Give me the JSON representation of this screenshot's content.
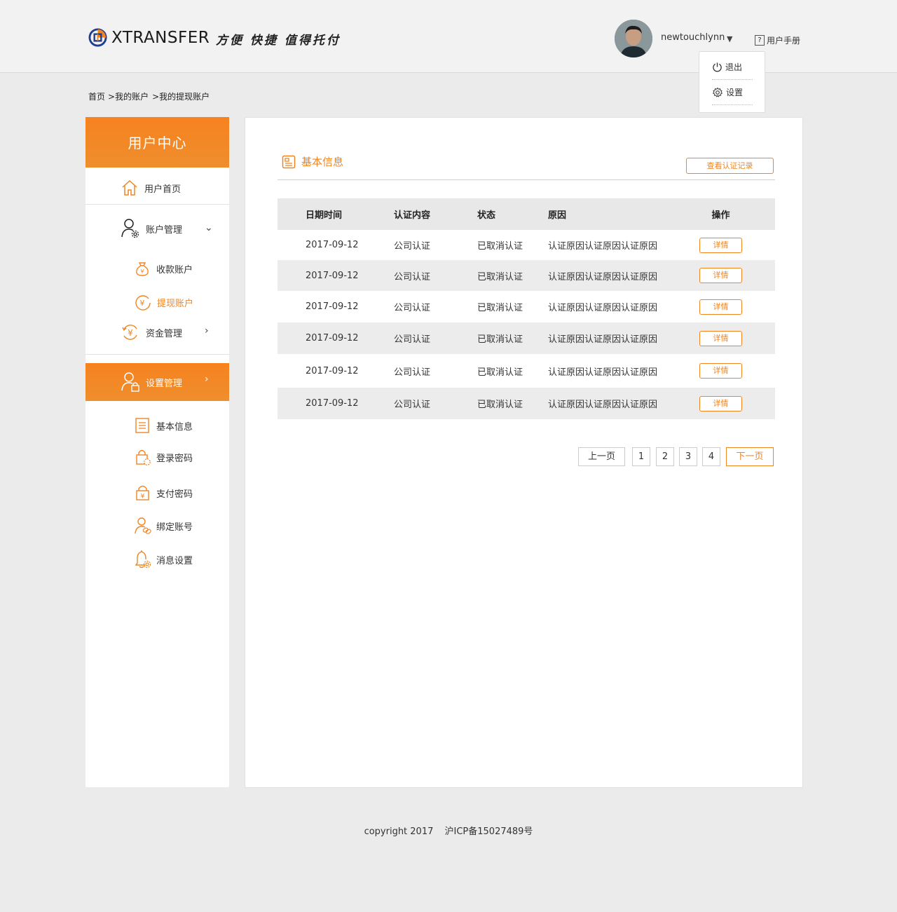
{
  "brand": {
    "name": "XTRANSFER",
    "slogan": "方便 快捷 值得托付"
  },
  "header": {
    "username": "newtouchlynn",
    "manual_label": "用户手册",
    "manual_icon_glyph": "?",
    "user_menu": {
      "logout_label": "退出",
      "settings_label": "设置"
    }
  },
  "breadcrumb": [
    "首页",
    ">我的账户",
    ">我的提现账户"
  ],
  "sidebar": {
    "title": "用户中心",
    "home_label": "用户首页",
    "account_mgmt_label": "账户管理",
    "receive_account_label": "收款账户",
    "withdraw_account_label": "提现账户",
    "fund_mgmt_label": "资金管理",
    "settings_mgmt_label": "设置管理",
    "basic_info_label": "基本信息",
    "login_password_label": "登录密码",
    "pay_password_label": "支付密码",
    "bind_account_label": "绑定账号",
    "message_settings_label": "消息设置"
  },
  "main": {
    "section_title": "基本信息",
    "record_button": "查看认证记录",
    "table": {
      "headers": [
        "日期时间",
        "认证内容",
        "状态",
        "原因",
        "操作"
      ],
      "rows": [
        [
          "2017-09-12",
          "公司认证",
          "已取消认证",
          "认证原因认证原因认证原因",
          "详情"
        ],
        [
          "2017-09-12",
          "公司认证",
          "已取消认证",
          "认证原因认证原因认证原因",
          "详情"
        ],
        [
          "2017-09-12",
          "公司认证",
          "已取消认证",
          "认证原因认证原因认证原因",
          "详情"
        ],
        [
          "2017-09-12",
          "公司认证",
          "已取消认证",
          "认证原因认证原因认证原因",
          "详情"
        ],
        [
          "2017-09-12",
          "公司认证",
          "已取消认证",
          "认证原因认证原因认证原因",
          "详情"
        ],
        [
          "2017-09-12",
          "公司认证",
          "已取消认证",
          "认证原因认证原因认证原因",
          "详情"
        ]
      ]
    },
    "pagination": {
      "prev": "上一页",
      "pages": [
        "1",
        "2",
        "3",
        "4"
      ],
      "next": "下一页"
    }
  },
  "footer": {
    "copyright": "copyright 2017",
    "icp": "沪ICP备15027489号"
  },
  "colors": {
    "accent": "#f08522",
    "sidebar_gradient_top": "#f6821f",
    "sidebar_gradient_bottom": "#ef8e2d",
    "page_bg": "#ebebeb",
    "header_bg": "#f2f2f2",
    "row_alt_bg": "#ececec"
  },
  "icons": {
    "logo": "xtransfer-logo-icon",
    "caret": "caret-down-icon",
    "manual": "question-box-icon",
    "logout": "power-icon",
    "settings": "gear-icon",
    "home": "home-icon",
    "account_mgmt": "user-gear-icon",
    "receive": "money-bag-icon",
    "withdraw": "yuan-circle-icon",
    "fund": "yuan-exchange-icon",
    "settings_mgmt": "user-lock-icon",
    "basic_info": "document-icon",
    "login_password": "lock-gear-icon",
    "pay_password": "lock-yuan-icon",
    "bind_account": "user-link-icon",
    "message_settings": "bell-gear-icon",
    "section": "id-card-icon"
  }
}
